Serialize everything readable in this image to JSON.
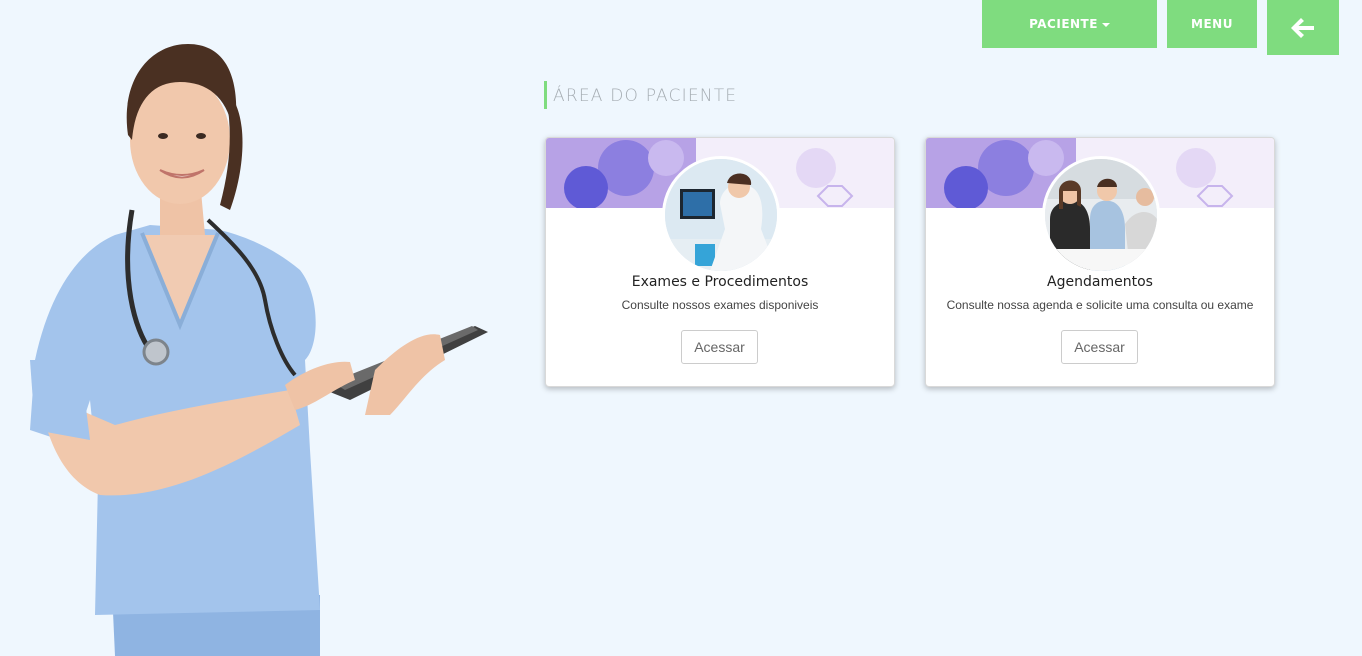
{
  "nav": {
    "paciente_label": "PACIENTE",
    "menu_label": "MENU",
    "back_icon": "arrow-left-icon"
  },
  "section": {
    "title": "ÁREA DO PACIENTE"
  },
  "cards": [
    {
      "title": "Exames e Procedimentos",
      "description": "Consulte nossos exames disponiveis",
      "button": "Acessar"
    },
    {
      "title": "Agendamentos",
      "description": "Consulte nossa agenda e solicite uma consulta ou exame",
      "button": "Acessar"
    }
  ],
  "colors": {
    "accent": "#7fdc7f",
    "background": "#eff7fe"
  }
}
